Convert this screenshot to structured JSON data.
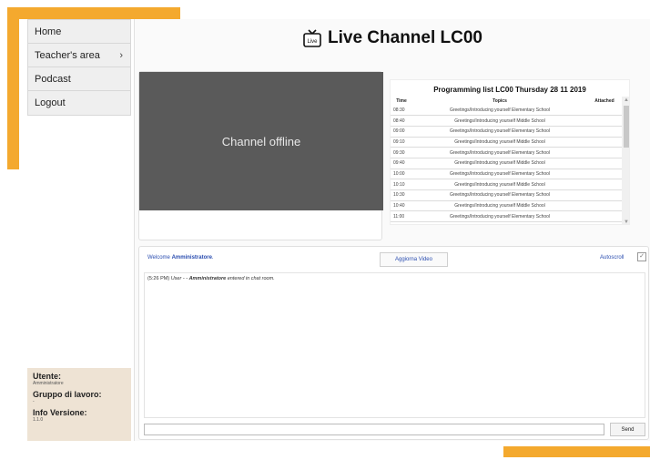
{
  "sidebar": {
    "items": [
      {
        "label": "Home"
      },
      {
        "label": "Teacher's area",
        "chevron": "›"
      },
      {
        "label": "Podcast"
      },
      {
        "label": "Logout"
      }
    ]
  },
  "user_info": {
    "user_label": "Utente:",
    "user_value": "Amministratore",
    "group_label": "Gruppo di lavoro:",
    "group_value": "-",
    "version_label": "Info Versione:",
    "version_value": "1.1.0"
  },
  "header": {
    "title": "Live Channel LC00",
    "tv_icon": "tv-icon",
    "tv_icon_text": "Live"
  },
  "video": {
    "status_text": "Channel offline"
  },
  "programming": {
    "title": "Programming list LC00 Thursday 28 11 2019",
    "columns": [
      "Time",
      "Topics",
      "Attached"
    ],
    "rows": [
      {
        "time": "08:30",
        "topic": "Greetings/Introducing yourself Elementary School"
      },
      {
        "time": "08:40",
        "topic": "Greetings/Introducing yourself Middle School"
      },
      {
        "time": "09:00",
        "topic": "Greetings/Introducing yourself Elementary School"
      },
      {
        "time": "09:10",
        "topic": "Greetings/Introducing yourself Middle School"
      },
      {
        "time": "09:30",
        "topic": "Greetings/Introducing yourself Elementary School"
      },
      {
        "time": "09:40",
        "topic": "Greetings/Introducing yourself Middle School"
      },
      {
        "time": "10:00",
        "topic": "Greetings/Introducing yourself Elementary School"
      },
      {
        "time": "10:10",
        "topic": "Greetings/Introducing yourself Middle School"
      },
      {
        "time": "10:30",
        "topic": "Greetings/Introducing yourself Elementary School"
      },
      {
        "time": "10:40",
        "topic": "Greetings/Introducing yourself Middle School"
      },
      {
        "time": "11:00",
        "topic": "Greetings/Introducing yourself Elementary School"
      }
    ]
  },
  "chat": {
    "welcome_prefix": "Welcome",
    "welcome_user": "Amministratore",
    "welcome_suffix": ".",
    "refresh_label": "Aggiorna Video",
    "autoscroll_label": "Autoscroll",
    "autoscroll_checked": true,
    "messages": [
      {
        "time": "(5:26 PM)",
        "sender": "User",
        "separator": " - - ",
        "actor": "Amministratore",
        "text": " entered in chat room."
      }
    ],
    "input_value": "",
    "send_label": "Send"
  },
  "colors": {
    "accent_orange": "#f4a92e",
    "link_blue": "#2a4db0",
    "video_bg": "#5a5a5a",
    "info_box_bg": "#eee3d4"
  }
}
